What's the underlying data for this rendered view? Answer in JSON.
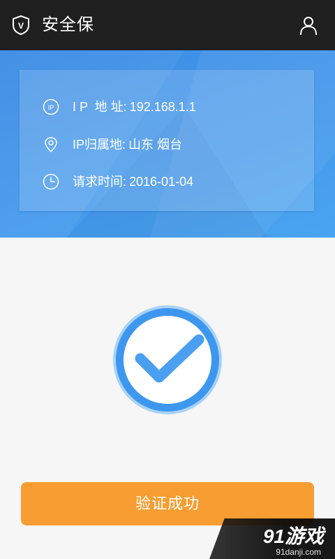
{
  "app": {
    "title": "安全保",
    "shield_letter": "V"
  },
  "icons": {
    "shield": "shield-v-icon",
    "user": "user-icon",
    "ip": "ip-icon",
    "location": "location-pin-icon",
    "clock": "clock-icon",
    "check": "checkmark-circle-icon",
    "ip_icon_text": "IP"
  },
  "info": {
    "rows": [
      {
        "label": "I P  地 址:",
        "value": "192.168.1.1"
      },
      {
        "label": "IP归属地:",
        "value": "山东 烟台"
      },
      {
        "label": "请求时间:",
        "value": "2016-01-04"
      }
    ]
  },
  "status": {
    "button_label": "验证成功"
  },
  "watermark": {
    "logo": "91游戏",
    "domain": "91danji.com"
  },
  "colors": {
    "topbar": "#1f1f1f",
    "header_blue": "#4396ea",
    "check_blue": "#3e97ef",
    "button_orange": "#f89d31",
    "background": "#f6f6f6"
  }
}
